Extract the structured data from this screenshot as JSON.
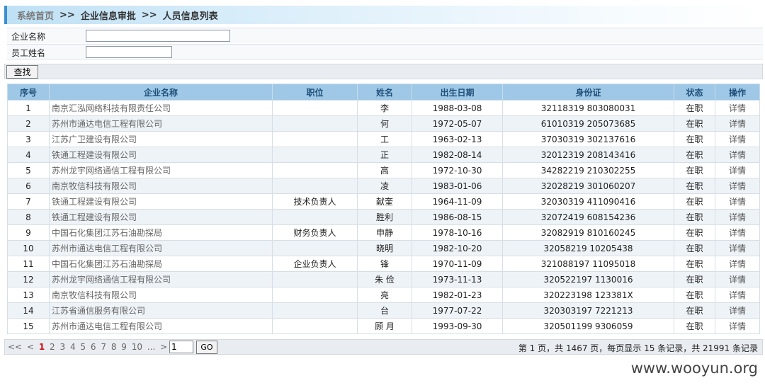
{
  "breadcrumb": {
    "home": "系统首页",
    "sep": ">>",
    "level2": "企业信息审批",
    "level3": "人员信息列表"
  },
  "form": {
    "company_label": "企业名称",
    "company_value": "",
    "employee_label": "员工姓名",
    "employee_value": ""
  },
  "search_button": "查找",
  "table": {
    "headers": [
      "序号",
      "企业名称",
      "职位",
      "姓名",
      "出生日期",
      "身份证",
      "状态",
      "操作"
    ],
    "rows": [
      [
        "1",
        "南京汇泓网络科技有限责任公司",
        "",
        "李",
        "1988-03-08",
        "32118319 803080031",
        "在职",
        "详情"
      ],
      [
        "2",
        "苏州市通达电信工程有限公司",
        "",
        "何",
        "1972-05-07",
        "61010319 205073685",
        "在职",
        "详情"
      ],
      [
        "3",
        "江苏广卫建设有限公司",
        "",
        "工",
        "1963-02-13",
        "37030319 302137616",
        "在职",
        "详情"
      ],
      [
        "4",
        "铁通工程建设有限公司",
        "",
        "正",
        "1982-08-14",
        "32012319 208143416",
        "在职",
        "详情"
      ],
      [
        "5",
        "苏州龙宇网络通信工程有限公司",
        "",
        "高",
        "1972-10-30",
        "34282219 210302255",
        "在职",
        "详情"
      ],
      [
        "6",
        "南京牧信科技有限公司",
        "",
        "凌",
        "1983-01-06",
        "32028219 301060207",
        "在职",
        "详情"
      ],
      [
        "7",
        "铁通工程建设有限公司",
        "技术负责人",
        "献奎",
        "1964-11-09",
        "32030319 411090416",
        "在职",
        "详情"
      ],
      [
        "8",
        "铁通工程建设有限公司",
        "",
        "胜利",
        "1986-08-15",
        "32072419 608154236",
        "在职",
        "详情"
      ],
      [
        "9",
        "中国石化集团江苏石油勘探局",
        "财务负责人",
        "申静",
        "1978-10-16",
        "32082919 810160245",
        "在职",
        "详情"
      ],
      [
        "10",
        "苏州市通达电信工程有限公司",
        "",
        "晓明",
        "1982-10-20",
        "32058219 10205438",
        "在职",
        "详情"
      ],
      [
        "11",
        "中国石化集团江苏石油勘探局",
        "企业负责人",
        "锋",
        "1970-11-09",
        "321088197 11095018",
        "在职",
        "详情"
      ],
      [
        "12",
        "苏州龙宇网络通信工程有限公司",
        "",
        "朱 俭",
        "1973-11-13",
        "320522197 1130016",
        "在职",
        "详情"
      ],
      [
        "13",
        "南京牧信科技有限公司",
        "",
        "亮",
        "1982-01-23",
        "320223198 123381X",
        "在职",
        "详情"
      ],
      [
        "14",
        "江苏省通信服务有限公司",
        "",
        "台",
        "1977-07-22",
        "320303197 7221213",
        "在职",
        "详情"
      ],
      [
        "15",
        "苏州市通达电信工程有限公司",
        "",
        "顾 月",
        "1993-09-30",
        "320501199 9306059",
        "在职",
        "详情"
      ]
    ]
  },
  "pager": {
    "first": "<<",
    "prev": "<",
    "current": "1",
    "pages": [
      "2",
      "3",
      "4",
      "5",
      "6",
      "7",
      "8",
      "9",
      "10",
      "..."
    ],
    "next": ">",
    "last": ">>",
    "goto_value": "1",
    "go_label": "GO",
    "info": "第 1 页，共 1467 页，每页显示 15 条记录，共 21991 条记录"
  },
  "watermark": "www.wooyun.org"
}
